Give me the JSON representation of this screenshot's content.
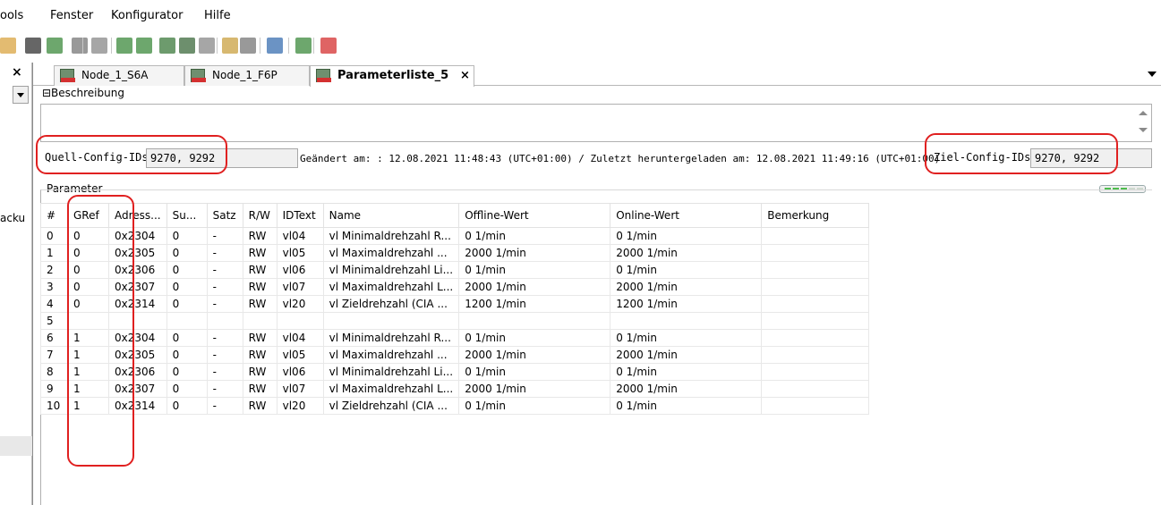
{
  "menubar": {
    "items": [
      "ools",
      "Fenster",
      "Konfigurator",
      "Hilfe"
    ]
  },
  "toolbar": {
    "buttons": [
      {
        "name": "paste-icon"
      },
      {
        "name": "delete-icon"
      },
      {
        "name": "device-icon"
      },
      {
        "name": "tree-icon"
      },
      {
        "name": "export-icon"
      },
      {
        "name": "config-a-icon"
      },
      {
        "name": "config-b-icon"
      },
      {
        "name": "upload-icon"
      },
      {
        "name": "download-icon"
      },
      {
        "name": "zoom-icon"
      },
      {
        "name": "wrench-icon"
      },
      {
        "name": "copy-icon"
      },
      {
        "name": "chart-icon"
      },
      {
        "name": "list-icon"
      },
      {
        "name": "keb-icon"
      }
    ]
  },
  "left_panel": {
    "close_glyph": "×",
    "partial_text": "acku"
  },
  "tabs": [
    {
      "label": "Node_1_S6A",
      "active": false
    },
    {
      "label": "Node_1_F6P",
      "active": false
    },
    {
      "label": "Parameterliste_5",
      "active": true,
      "close_glyph": "×"
    }
  ],
  "description": {
    "header": "⊟Beschreibung",
    "value": ""
  },
  "config": {
    "source_label": "Quell-Config-IDs:",
    "source_value": "9270, 9292",
    "changed_info": "Geändert am: : 12.08.2021 11:48:43 (UTC+01:00) / Zuletzt heruntergeladen am: 12.08.2021 11:49:16 (UTC+01:00)",
    "target_label": "Ziel-Config-IDs:",
    "target_value": "9270, 9292"
  },
  "parameters": {
    "header": "Parameter",
    "columns": [
      "#",
      "GRef",
      "Adress...",
      "Su...",
      "Satz",
      "R/W",
      "IDText",
      "Name",
      "Offline-Wert",
      "Online-Wert",
      "Bemerkung"
    ],
    "rows": [
      [
        "0",
        "0",
        "0x2304",
        "0",
        "-",
        "RW",
        "vl04",
        "vl Minimaldrehzahl R...",
        "0 1/min",
        "0 1/min",
        ""
      ],
      [
        "1",
        "0",
        "0x2305",
        "0",
        "-",
        "RW",
        "vl05",
        "vl Maximaldrehzahl ...",
        "2000 1/min",
        "2000 1/min",
        ""
      ],
      [
        "2",
        "0",
        "0x2306",
        "0",
        "-",
        "RW",
        "vl06",
        "vl Minimaldrehzahl Li...",
        "0 1/min",
        "0 1/min",
        ""
      ],
      [
        "3",
        "0",
        "0x2307",
        "0",
        "-",
        "RW",
        "vl07",
        "vl Maximaldrehzahl L...",
        "2000 1/min",
        "2000 1/min",
        ""
      ],
      [
        "4",
        "0",
        "0x2314",
        "0",
        "-",
        "RW",
        "vl20",
        "vl Zieldrehzahl (CIA ...",
        "1200 1/min",
        "1200 1/min",
        ""
      ],
      [
        "5",
        "",
        "",
        "",
        "",
        "",
        "",
        "",
        "",
        "",
        ""
      ],
      [
        "6",
        "1",
        "0x2304",
        "0",
        "-",
        "RW",
        "vl04",
        "vl Minimaldrehzahl R...",
        "0 1/min",
        "0 1/min",
        ""
      ],
      [
        "7",
        "1",
        "0x2305",
        "0",
        "-",
        "RW",
        "vl05",
        "vl Maximaldrehzahl ...",
        "2000 1/min",
        "2000 1/min",
        ""
      ],
      [
        "8",
        "1",
        "0x2306",
        "0",
        "-",
        "RW",
        "vl06",
        "vl Minimaldrehzahl Li...",
        "0 1/min",
        "0 1/min",
        ""
      ],
      [
        "9",
        "1",
        "0x2307",
        "0",
        "-",
        "RW",
        "vl07",
        "vl Maximaldrehzahl L...",
        "2000 1/min",
        "2000 1/min",
        ""
      ],
      [
        "10",
        "1",
        "0x2314",
        "0",
        "-",
        "RW",
        "vl20",
        "vl Zieldrehzahl (CIA ...",
        "0 1/min",
        "0 1/min",
        ""
      ]
    ]
  },
  "annotation_color": "#e02020"
}
